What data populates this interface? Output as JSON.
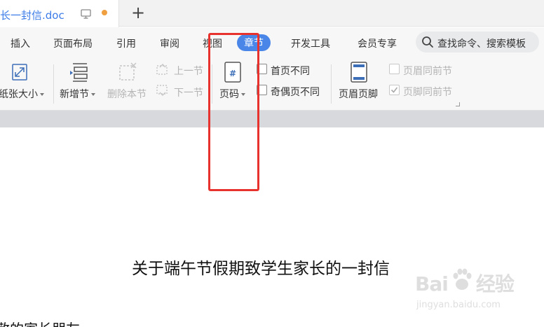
{
  "tab": {
    "title": "长一封信.doc"
  },
  "menu": {
    "items": [
      "插入",
      "页面布局",
      "引用",
      "审阅",
      "视图",
      "章节",
      "开发工具",
      "会员专享"
    ],
    "active": "章节",
    "search_placeholder": "查找命令、搜索模板"
  },
  "ribbon": {
    "paper_size": "纸张大小",
    "new_section": "新增节",
    "delete_section": "删除本节",
    "prev_section": "上一节",
    "next_section": "下一节",
    "page_number": "页码",
    "first_page_diff": "首页不同",
    "odd_even_diff": "奇偶页不同",
    "header_footer": "页眉页脚",
    "header_same_prev": "页眉同前节",
    "footer_same_prev": "页脚同前节"
  },
  "document": {
    "heading": "关于端午节假期致学生家长的一封信",
    "salutation": "敬的家长朋友"
  },
  "watermark": {
    "brand": "Bai",
    "brand_tail": "经验",
    "url": "jingyan.baidu.com"
  },
  "colors": {
    "accent": "#4a86e8",
    "highlight": "#e8322e",
    "tab_title": "#3b7be8",
    "unsaved_dot": "#f0a040"
  }
}
